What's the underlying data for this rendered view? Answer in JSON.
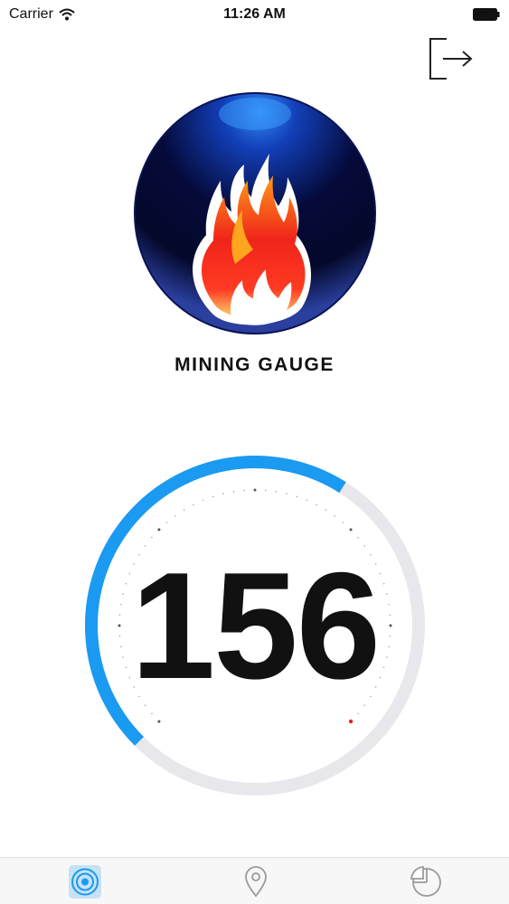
{
  "status_bar": {
    "carrier": "Carrier",
    "time": "11:26 AM"
  },
  "header": {
    "logout_icon": "logout-icon"
  },
  "logo": {
    "icon": "flame-logo"
  },
  "app": {
    "title": "MINING GAUGE"
  },
  "gauge": {
    "value": "156",
    "level_fraction": 0.62,
    "accent_color": "#1a9af0",
    "track_color": "#e8e8ec"
  },
  "tab_bar": {
    "tabs": [
      {
        "icon": "gauge-icon",
        "selected": true
      },
      {
        "icon": "location-pin-icon",
        "selected": false
      },
      {
        "icon": "pie-chart-icon",
        "selected": false
      }
    ]
  }
}
